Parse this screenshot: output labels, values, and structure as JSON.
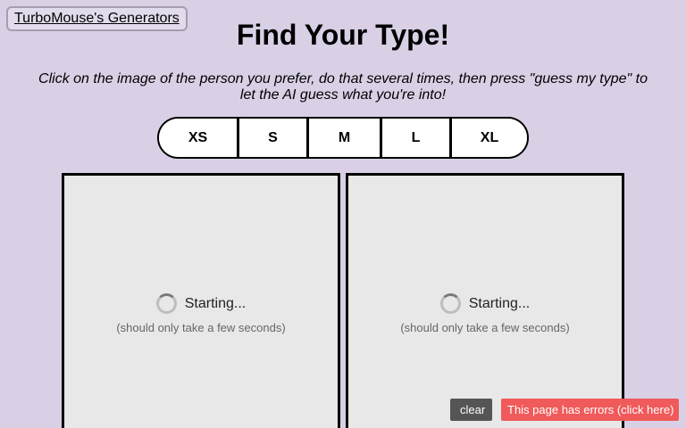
{
  "header": {
    "brand_link": "TurboMouse's Generators",
    "title": "Find Your Type!",
    "instructions": "Click on the image of the person you prefer, do that several times, then press \"guess my type\" to let the AI guess what you're into!"
  },
  "size_options": [
    "XS",
    "S",
    "M",
    "L",
    "XL"
  ],
  "panels": {
    "left": {
      "status": "Starting...",
      "hint": "(should only take a few seconds)"
    },
    "right": {
      "status": "Starting...",
      "hint": "(should only take a few seconds)"
    }
  },
  "footer_tools": {
    "clear_icon": "",
    "clear_label": "clear",
    "error_label": "This page has errors (click here)"
  },
  "colors": {
    "background": "#d9d0e6",
    "panel": "#e8e8e8",
    "clear_button": "#555555",
    "error_button": "#f05a5a"
  }
}
